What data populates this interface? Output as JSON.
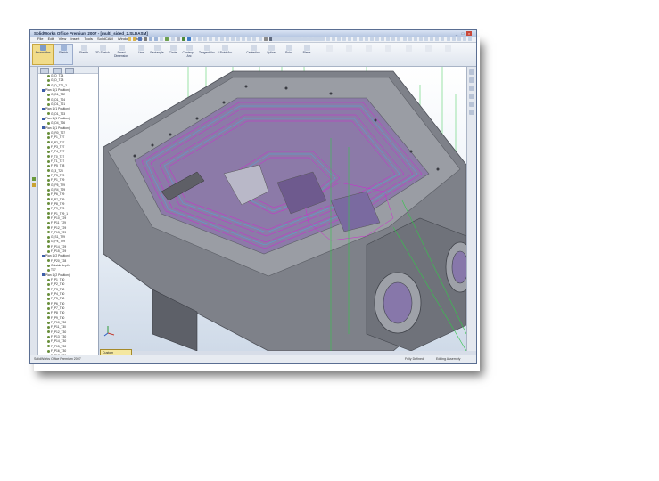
{
  "window": {
    "title": "SolidWorks Office Premium 2007 - [multi_sided_2.SLDASM]",
    "controls": [
      "_",
      "□",
      "×"
    ]
  },
  "menu": [
    "File",
    "Edit",
    "View",
    "Insert",
    "Tools",
    "SolidCAM",
    "Window",
    "Help"
  ],
  "ribbon": {
    "buttons": [
      {
        "label": "Assemblies",
        "icon": "assembly-icon"
      },
      {
        "label": "Sketch",
        "icon": "sketch-icon"
      },
      {
        "label": "Sketch",
        "icon": "sketch-icon"
      },
      {
        "label": "3D Sketch",
        "icon": "3d-sketch-icon"
      },
      {
        "label": "Smart Dimension",
        "icon": "smart-dimension-icon"
      },
      {
        "label": "Line",
        "icon": "line-icon"
      },
      {
        "label": "Rectangle",
        "icon": "rectangle-icon"
      },
      {
        "label": "Circle",
        "icon": "circle-icon"
      },
      {
        "label": "Centerp... Arc",
        "icon": "centerpoint-arc-icon"
      },
      {
        "label": "Tangent Arc",
        "icon": "tangent-arc-icon"
      },
      {
        "label": "3 Point Arc",
        "icon": "3point-arc-icon"
      },
      {
        "label": "Centerline",
        "icon": "centerline-icon"
      },
      {
        "label": "Spline",
        "icon": "spline-icon"
      },
      {
        "label": "Point",
        "icon": "point-icon"
      },
      {
        "label": "Plane",
        "icon": "plane-icon"
      }
    ]
  },
  "tree": {
    "items": [
      {
        "label": "G_D_T24",
        "kind": "op"
      },
      {
        "label": "G_D_T28",
        "kind": "op"
      },
      {
        "label": "G_D_T21_2",
        "kind": "op"
      },
      {
        "label": "Plan 1 (1 Position)",
        "kind": "plan"
      },
      {
        "label": "G_D1_T22",
        "kind": "op"
      },
      {
        "label": "G_D1_T24",
        "kind": "op"
      },
      {
        "label": "G_D1_T21",
        "kind": "op"
      },
      {
        "label": "Plan 1 (1 Position)",
        "kind": "plan"
      },
      {
        "label": "G_D1_T23",
        "kind": "op"
      },
      {
        "label": "Plan 1 (1 Position)",
        "kind": "plan"
      },
      {
        "label": "G_D4_T26",
        "kind": "op"
      },
      {
        "label": "Plan 1 (1 Position)",
        "kind": "plan"
      },
      {
        "label": "G_R0_T27",
        "kind": "op"
      },
      {
        "label": "F_P1_T27",
        "kind": "op"
      },
      {
        "label": "F_P2_T27",
        "kind": "op"
      },
      {
        "label": "F_P3_T27",
        "kind": "op"
      },
      {
        "label": "F_P4_T27",
        "kind": "op"
      },
      {
        "label": "F_T0_T27",
        "kind": "op"
      },
      {
        "label": "F_T1_T27",
        "kind": "op"
      },
      {
        "label": "F_P5_T28",
        "kind": "op"
      },
      {
        "label": "G_3_T28",
        "kind": "op"
      },
      {
        "label": "F_P5_T29",
        "kind": "op"
      },
      {
        "label": "F_P1_T29",
        "kind": "op"
      },
      {
        "label": "G_P5_T29",
        "kind": "op"
      },
      {
        "label": "G_R4_T29",
        "kind": "op"
      },
      {
        "label": "F_P6_T29",
        "kind": "op"
      },
      {
        "label": "F_P7_T29",
        "kind": "op"
      },
      {
        "label": "F_P8_T29",
        "kind": "op"
      },
      {
        "label": "F_P9_T29",
        "kind": "op"
      },
      {
        "label": "F_P1_T29_1",
        "kind": "op"
      },
      {
        "label": "F_P10_T29",
        "kind": "op"
      },
      {
        "label": "F_P11_T29",
        "kind": "op"
      },
      {
        "label": "F_P12_T29",
        "kind": "op"
      },
      {
        "label": "F_P13_T29",
        "kind": "op"
      },
      {
        "label": "G_S1_T29",
        "kind": "op"
      },
      {
        "label": "G_P4_T29",
        "kind": "op"
      },
      {
        "label": "F_P14_T29",
        "kind": "op"
      },
      {
        "label": "F_P15_T29",
        "kind": "op"
      },
      {
        "label": "Plan 1 (2 Position)",
        "kind": "plan"
      },
      {
        "label": "F_P20_T28",
        "kind": "op"
      },
      {
        "label": "Outside depth",
        "kind": "op"
      },
      {
        "label": "T17",
        "kind": "op"
      },
      {
        "label": "Plan 1 (2 Position)",
        "kind": "plan"
      },
      {
        "label": "F_P1_T30",
        "kind": "op"
      },
      {
        "label": "F_P2_T30",
        "kind": "op"
      },
      {
        "label": "F_P3_T30",
        "kind": "op"
      },
      {
        "label": "F_P4_T30",
        "kind": "op"
      },
      {
        "label": "F_P5_T30",
        "kind": "op"
      },
      {
        "label": "F_P6_T30",
        "kind": "op"
      },
      {
        "label": "F_P7_T30",
        "kind": "op"
      },
      {
        "label": "F_P8_T30",
        "kind": "op"
      },
      {
        "label": "F_P9_T30",
        "kind": "op"
      },
      {
        "label": "F_P10_T30",
        "kind": "op"
      },
      {
        "label": "F_P11_T30",
        "kind": "op"
      },
      {
        "label": "F_P12_T30",
        "kind": "op"
      },
      {
        "label": "F_P13_T30",
        "kind": "op"
      },
      {
        "label": "F_P14_T30",
        "kind": "op"
      },
      {
        "label": "F_P15_T30",
        "kind": "op"
      },
      {
        "label": "F_P16_T30",
        "kind": "op"
      },
      {
        "label": "F_P17_T30",
        "kind": "op"
      }
    ]
  },
  "viewport": {
    "view_name": "Custom"
  },
  "status": {
    "left": "SolidWorks Office Premium 2007",
    "state": "Fully Defined",
    "mode": "Editing Assembly"
  },
  "colors": {
    "toolpath_green": "#33c64a",
    "toolpath_magenta": "#d227d2",
    "toolpath_cyan": "#3fb8d8",
    "part_gray": "#8c8f96"
  }
}
